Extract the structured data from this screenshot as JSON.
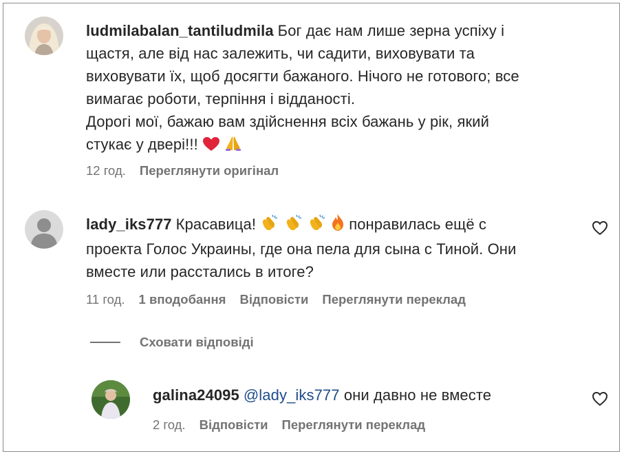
{
  "comments": [
    {
      "username": "ludmilabalan_tantiludmila",
      "lines": [
        "Бог дає нам лише зерна успіху і",
        "щастя, але від нас залежить, чи садити, виховувати та",
        "виховувати їх, щоб досягти бажаного. Нічого не готового; все",
        "вимагає роботи, терпіння і відданості.",
        "Дорогі мої, бажаю вам здійснення всіх бажань у рік, який",
        "стукає у двері!!!"
      ],
      "emojis": [
        "red-heart",
        "folded-hands"
      ],
      "time": "12 год.",
      "actions": [
        "Переглянути оригінал"
      ]
    },
    {
      "username": "lady_iks777",
      "lines": [
        "Красавица!",
        "понравилась ещё с",
        "проекта Голос Украины, где она пела для сына с Тиной. Они",
        "вместе или расстались в итоге?"
      ],
      "emojis": [
        "clapping-hands",
        "clapping-hands",
        "clapping-hands",
        "fire"
      ],
      "time": "11 год.",
      "likes": "1 вподобання",
      "actions": [
        "Відповісти",
        "Переглянути переклад"
      ]
    }
  ],
  "hide_replies_label": "Сховати відповіді",
  "reply": {
    "username": "galina24095",
    "mention": "@lady_iks777",
    "text": "они давно не вместе",
    "time": "2 год.",
    "actions": [
      "Відповісти",
      "Переглянути переклад"
    ]
  },
  "colors": {
    "text": "#262626",
    "muted": "#737373",
    "mention": "#1f4b8a",
    "heart": "#e0243a"
  }
}
